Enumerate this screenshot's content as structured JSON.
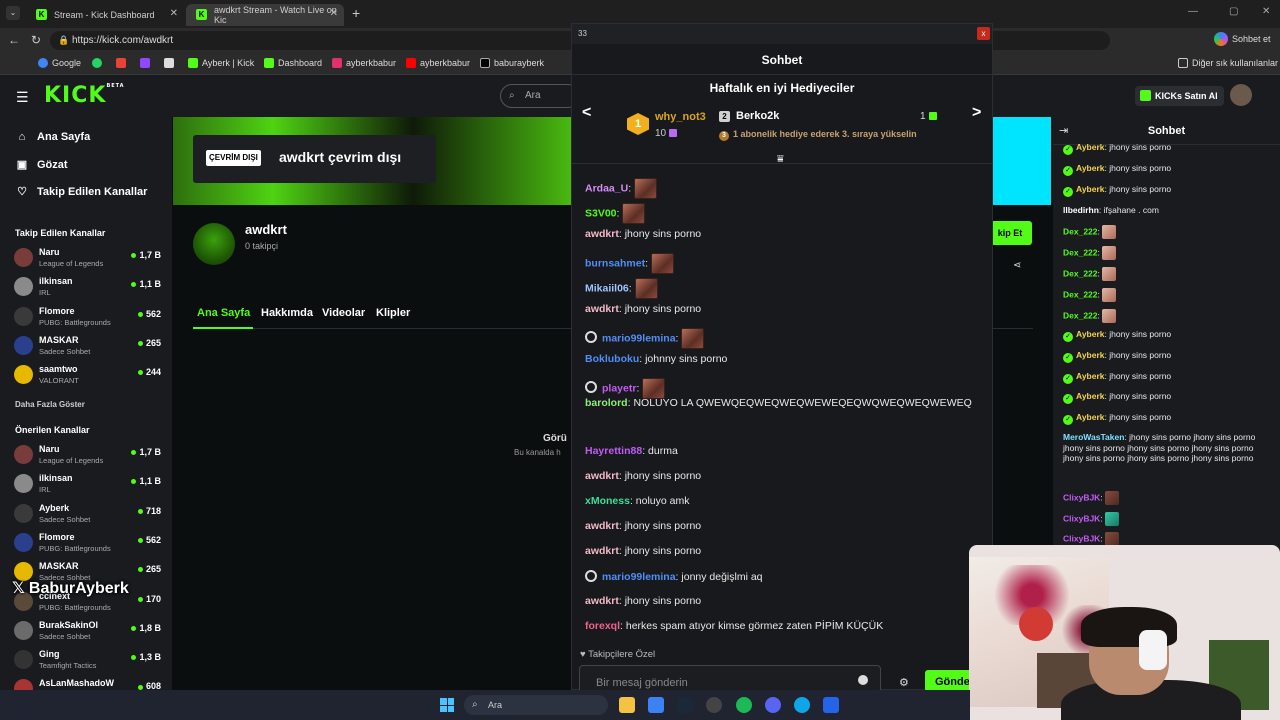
{
  "browser": {
    "tabs": [
      {
        "title": "Stream - Kick Dashboard"
      },
      {
        "title": "awdkrt Stream - Watch Live on Kic"
      }
    ],
    "url": "https://kick.com/awdkrt",
    "copilot_label": "Sohbet et",
    "bookmarks": [
      {
        "label": "Google",
        "color": "#4285f4"
      },
      {
        "label": "Ayberk | Kick",
        "color": "#53fc18"
      },
      {
        "label": "Dashboard",
        "color": "#53fc18"
      },
      {
        "label": "ayberkbabur",
        "color": "#e1306c"
      },
      {
        "label": "ayberkbabur",
        "color": "#ff0000"
      },
      {
        "label": "baburayberk",
        "color": "#ffffff"
      }
    ],
    "other_bookmarks": "Diğer sık kullanılanlar"
  },
  "header": {
    "logo": "KICK",
    "logo_sup": "BETA",
    "search_placeholder": "Ara",
    "kicks_button": "KICKs Satın Al"
  },
  "sidebar": {
    "main_items": [
      {
        "label": "Ana Sayfa",
        "icon": "home-icon"
      },
      {
        "label": "Gözat",
        "icon": "browse-icon"
      },
      {
        "label": "Takip Edilen Kanallar",
        "icon": "heart-icon"
      }
    ],
    "followed_title": "Takip Edilen Kanallar",
    "followed": [
      {
        "name": "Naru",
        "category": "League of Legends",
        "viewers": "1,7 B"
      },
      {
        "name": "ilkinsan",
        "category": "IRL",
        "viewers": "1,1 B"
      },
      {
        "name": "Flomore",
        "category": "PUBG: Battlegrounds",
        "viewers": "562"
      },
      {
        "name": "MASKAR",
        "category": "Sadece Sohbet",
        "viewers": "265"
      },
      {
        "name": "saamtwo",
        "category": "VALORANT",
        "viewers": "244"
      }
    ],
    "show_more": "Daha Fazla Göster",
    "recommended_title": "Önerilen Kanallar",
    "recommended": [
      {
        "name": "Naru",
        "category": "League of Legends",
        "viewers": "1,7 B"
      },
      {
        "name": "ilkinsan",
        "category": "IRL",
        "viewers": "1,1 B"
      },
      {
        "name": "Ayberk",
        "category": "Sadece Sohbet",
        "viewers": "718"
      },
      {
        "name": "Flomore",
        "category": "PUBG: Battlegrounds",
        "viewers": "562"
      },
      {
        "name": "MASKAR",
        "category": "Sadece Sohbet",
        "viewers": "265"
      },
      {
        "name": "ccinext",
        "category": "PUBG: Battlegrounds",
        "viewers": "170"
      },
      {
        "name": "BurakSakinOl",
        "category": "Sadece Sohbet",
        "viewers": "1,8 B"
      },
      {
        "name": "Ging",
        "category": "Teamfight Tactics",
        "viewers": "1,3 B"
      },
      {
        "name": "AsLanMashadoW",
        "category": "",
        "viewers": "608"
      }
    ]
  },
  "channel": {
    "offline_tag": "ÇEVRİM DIŞI",
    "offline_title": "awdkrt çevrim dışı",
    "name": "awdkrt",
    "followers": "0 takipçi",
    "tabs": [
      "Ana Sayfa",
      "Hakkımda",
      "Videolar",
      "Klipler"
    ],
    "empty_title": "Görü",
    "empty_sub": "Bu kanalda h",
    "follow_button": "kip Et"
  },
  "popup": {
    "window_number": "33",
    "title": "Sohbet",
    "gifters_title": "Haftalık en iyi Hediyeciler",
    "top_gifter": {
      "rank": "1",
      "name": "why_not3",
      "count": "10"
    },
    "second_gifter": {
      "name": "Berko2k",
      "count": "1"
    },
    "rank_note_num": "3",
    "rank_note": "1 abonelik hediye ederek 3. sıraya yükselin",
    "messages": [
      {
        "user": "Ardaa_U",
        "color": "#d58cf5",
        "text": "",
        "emote": true,
        "mod": false
      },
      {
        "user": "S3V00",
        "color": "#53fc18",
        "text": "",
        "emote": true,
        "mod": false
      },
      {
        "user": "awdkrt",
        "color": "#f2b9c7",
        "text": "jhony sins porno",
        "emote": false,
        "mod": false
      },
      {
        "user": "burnsahmet",
        "color": "#4f8ff7",
        "text": "",
        "emote": true,
        "mod": false
      },
      {
        "user": "Mikaiil06",
        "color": "#9ec6ff",
        "text": "",
        "emote": true,
        "mod": false
      },
      {
        "user": "awdkrt",
        "color": "#f2b9c7",
        "text": "jhony sins porno",
        "emote": false,
        "mod": false
      },
      {
        "user": "mario99lemina",
        "color": "#4f8ff7",
        "text": "",
        "emote": true,
        "mod": true
      },
      {
        "user": "Bokluboku",
        "color": "#4f8ff7",
        "text": "johnny sins porno",
        "emote": false,
        "mod": false
      },
      {
        "user": "playetr",
        "color": "#c15cf5",
        "text": "",
        "emote": true,
        "mod": true
      },
      {
        "user": "barolord",
        "color": "#8ef07a",
        "text": "NOLUYO LA QWEWQEQWEQWEQWEWEQEQWQWEQWEQWEWEQ",
        "emote": false,
        "mod": false
      },
      {
        "user": "Hayrettin88",
        "color": "#c15cf5",
        "text": "durma",
        "emote": false,
        "mod": false
      },
      {
        "user": "awdkrt",
        "color": "#f2b9c7",
        "text": "jhony sins porno",
        "emote": false,
        "mod": false
      },
      {
        "user": "xMoness",
        "color": "#3ddc97",
        "text": "noluyo amk",
        "emote": false,
        "mod": false
      },
      {
        "user": "awdkrt",
        "color": "#f2b9c7",
        "text": "jhony sins porno",
        "emote": false,
        "mod": false
      },
      {
        "user": "awdkrt",
        "color": "#f2b9c7",
        "text": "jhony sins porno",
        "emote": false,
        "mod": false
      },
      {
        "user": "mario99lemina",
        "color": "#4f8ff7",
        "text": "jonny değişlmi aq",
        "emote": false,
        "mod": true
      },
      {
        "user": "awdkrt",
        "color": "#f2b9c7",
        "text": "jhony sins porno",
        "emote": false,
        "mod": false
      },
      {
        "user": "forexql",
        "color": "#f2628b",
        "text": "herkes spam atıyor kimse görmez zaten PİPİM KÜÇÜK",
        "emote": false,
        "mod": false
      }
    ],
    "followers_only": "Takipçilere Özel",
    "input_placeholder": "Bir mesaj gönderin",
    "send_button": "Gönde"
  },
  "right_chat": {
    "title": "Sohbet",
    "messages": [
      {
        "user": "Ayberk",
        "color": "#f5d34a",
        "text": "jhony sins porno",
        "badge": true,
        "emote": ""
      },
      {
        "user": "Ayberk",
        "color": "#f5d34a",
        "text": "jhony sins porno",
        "badge": true,
        "emote": ""
      },
      {
        "user": "Ayberk",
        "color": "#f5d34a",
        "text": "jhony sins porno",
        "badge": true,
        "emote": ""
      },
      {
        "user": "llbedirhn",
        "color": "#ffffff",
        "text": "ifşahane . com",
        "badge": false,
        "emote": ""
      },
      {
        "user": "Dex_222",
        "color": "#53fc18",
        "text": "",
        "badge": false,
        "emote": "skin"
      },
      {
        "user": "Dex_222",
        "color": "#53fc18",
        "text": "",
        "badge": false,
        "emote": "skin"
      },
      {
        "user": "Dex_222",
        "color": "#53fc18",
        "text": "",
        "badge": false,
        "emote": "skin"
      },
      {
        "user": "Dex_222",
        "color": "#53fc18",
        "text": "",
        "badge": false,
        "emote": "skin"
      },
      {
        "user": "Dex_222",
        "color": "#53fc18",
        "text": "",
        "badge": false,
        "emote": "skin"
      },
      {
        "user": "Ayberk",
        "color": "#f5d34a",
        "text": "jhony sins porno",
        "badge": true,
        "emote": ""
      },
      {
        "user": "Ayberk",
        "color": "#f5d34a",
        "text": "jhony sins porno",
        "badge": true,
        "emote": ""
      },
      {
        "user": "Ayberk",
        "color": "#f5d34a",
        "text": "jhony sins porno",
        "badge": true,
        "emote": ""
      },
      {
        "user": "Ayberk",
        "color": "#f5d34a",
        "text": "jhony sins porno",
        "badge": true,
        "emote": ""
      },
      {
        "user": "Ayberk",
        "color": "#f5d34a",
        "text": "jhony sins porno",
        "badge": true,
        "emote": ""
      },
      {
        "user": "MeroWasTaken",
        "color": "#7ee2ff",
        "text": "jhony sins porno jhony sins porno jhony sins porno jhony sins porno jhony sins porno jhony sins porno jhony sins porno jhony sins porno",
        "badge": false,
        "emote": ""
      },
      {
        "user": "ClixyBJK",
        "color": "#c15cf5",
        "text": "",
        "badge": false,
        "emote": "brown"
      },
      {
        "user": "ClixyBJK",
        "color": "#c15cf5",
        "text": "",
        "badge": false,
        "emote": "teal"
      },
      {
        "user": "ClixyBJK",
        "color": "#c15cf5",
        "text": "",
        "badge": false,
        "emote": "brown"
      }
    ]
  },
  "watermark": "BaburAyberk",
  "taskbar": {
    "search_placeholder": "Ara"
  }
}
